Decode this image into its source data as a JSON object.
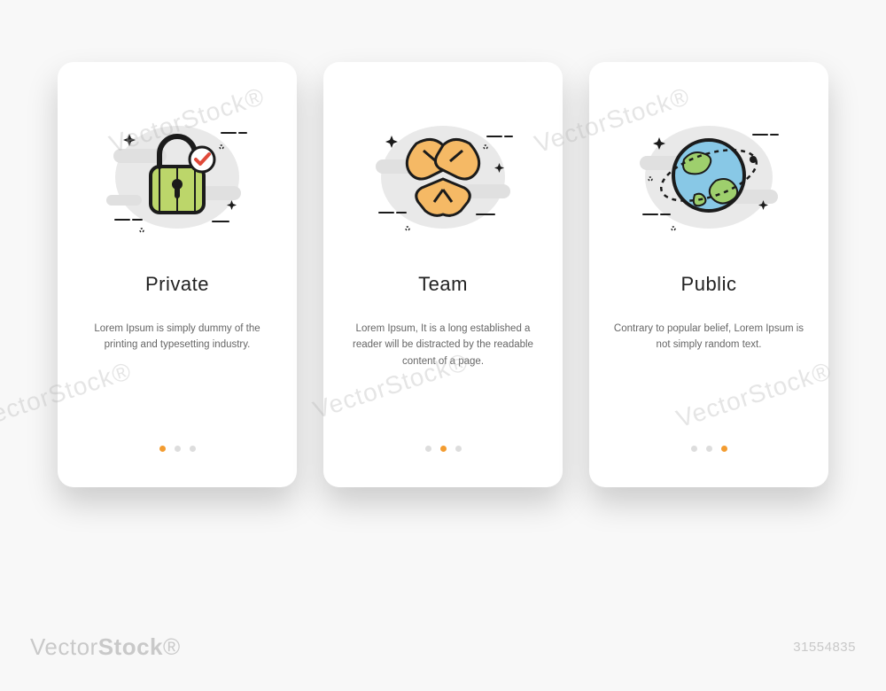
{
  "cards": [
    {
      "key": "private",
      "title": "Private",
      "desc": "Lorem Ipsum is simply dummy of the printing and typesetting industry.",
      "active_dot": 0,
      "icon": "lock-icon"
    },
    {
      "key": "team",
      "title": "Team",
      "desc": "Lorem Ipsum, It is a long established a reader will be distracted by the readable content of a page.",
      "active_dot": 1,
      "icon": "hands-icon"
    },
    {
      "key": "public",
      "title": "Public",
      "desc": "Contrary to popular belief, Lorem Ipsum is not simply random text.",
      "active_dot": 2,
      "icon": "globe-icon"
    }
  ],
  "dots_count": 3,
  "colors": {
    "accent": "#f39c30",
    "dot_inactive": "#dddddd",
    "lock_fill": "#bcd66a",
    "lock_stroke": "#1b1b1b",
    "check_red": "#e04a3a",
    "hands_fill": "#f5b965",
    "globe_water": "#88c8e6",
    "globe_land": "#9ecf6d",
    "cloud_grey": "#e0e0e0"
  },
  "footer": {
    "brand_thin": "Vector",
    "brand_bold": "Stock",
    "image_id": "31554835"
  },
  "watermark": "VectorStock®"
}
